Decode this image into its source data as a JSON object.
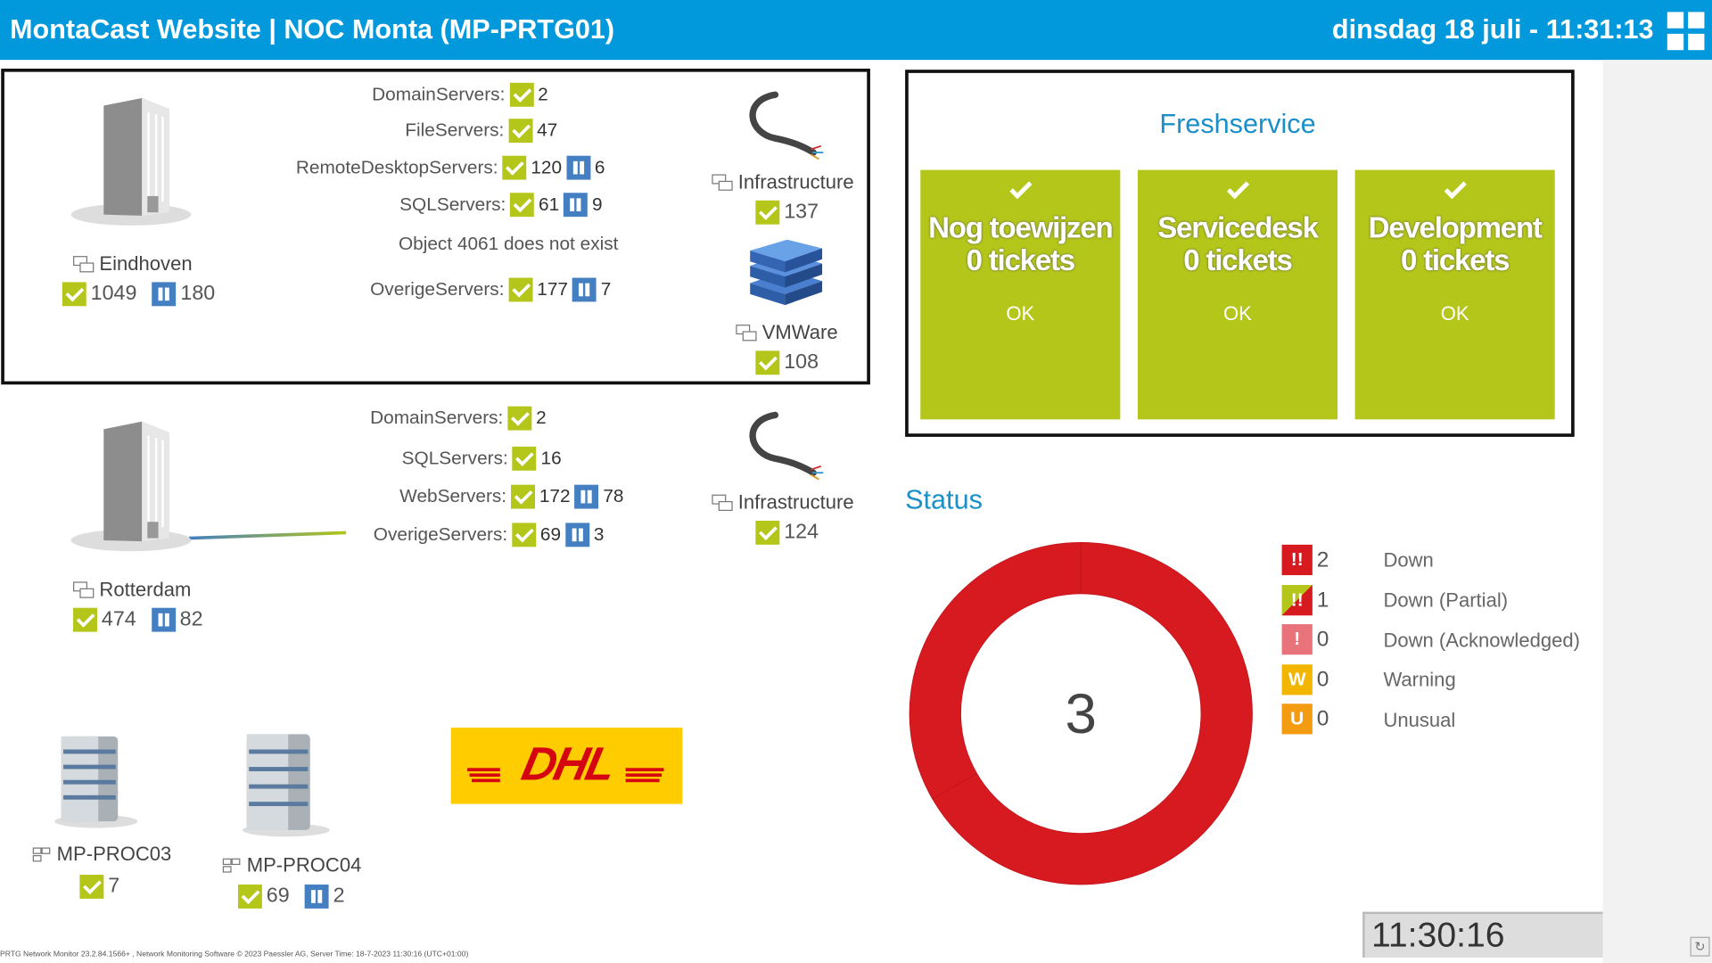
{
  "header": {
    "title": "MontaCast Website | NOC Monta (MP-PRTG01)",
    "datetime": "dinsdag 18 juli - 11:31:13"
  },
  "eindhoven": {
    "label": "Eindhoven",
    "up": "1049",
    "paused": "180",
    "rows": [
      {
        "label": "DomainServers:",
        "up": "2"
      },
      {
        "label": "FileServers:",
        "up": "47"
      },
      {
        "label": "RemoteDesktopServers:",
        "up": "120",
        "paused": "6"
      },
      {
        "label": "SQLServers:",
        "up": "61",
        "paused": "9"
      },
      {
        "label": "OverigeServers:",
        "up": "177",
        "paused": "7"
      }
    ],
    "missing": "Object 4061 does not exist",
    "infrastructure": {
      "label": "Infrastructure",
      "up": "137"
    },
    "vmware": {
      "label": "VMWare",
      "up": "108"
    }
  },
  "rotterdam": {
    "label": "Rotterdam",
    "up": "474",
    "paused": "82",
    "rows": [
      {
        "label": "DomainServers:",
        "up": "2"
      },
      {
        "label": "SQLServers:",
        "up": "16"
      },
      {
        "label": "WebServers:",
        "up": "172",
        "paused": "78"
      },
      {
        "label": "OverigeServers:",
        "up": "69",
        "paused": "3"
      }
    ],
    "infrastructure": {
      "label": "Infrastructure",
      "up": "124"
    }
  },
  "devices": [
    {
      "label": "MP-PROC03",
      "up": "7"
    },
    {
      "label": "MP-PROC04",
      "up": "69",
      "paused": "2"
    }
  ],
  "dhl": {
    "logo_text": "DHL",
    "colors": {
      "bg": "#ffcc00",
      "text": "#d40511"
    }
  },
  "freshservice": {
    "title": "Freshservice",
    "tiles": [
      {
        "name": "Nog toewijzen",
        "count": "0 tickets",
        "state": "OK"
      },
      {
        "name": "Servicedesk",
        "count": "0 tickets",
        "state": "OK"
      },
      {
        "name": "Development",
        "count": "0 tickets",
        "state": "OK"
      }
    ]
  },
  "status": {
    "title": "Status",
    "total": "3",
    "legend": [
      {
        "name": "Down",
        "count": "2",
        "icon": "!!",
        "color": "#d71920"
      },
      {
        "name": "Down (Partial)",
        "count": "1",
        "icon": "!!",
        "color": "#d71920"
      },
      {
        "name": "Down (Acknowledged)",
        "count": "0",
        "icon": "!",
        "color": "#e8737a"
      },
      {
        "name": "Warning",
        "count": "0",
        "icon": "W",
        "color": "#f2b500"
      },
      {
        "name": "Unusual",
        "count": "0",
        "icon": "U",
        "color": "#f39c12"
      }
    ]
  },
  "chart_data": {
    "type": "pie",
    "categories": [
      "Down",
      "Down (Partial)"
    ],
    "values": [
      2,
      1
    ],
    "colors": [
      "#d71920",
      "#d71920"
    ]
  },
  "footer": {
    "text": "PRTG Network Monitor 23.2.84.1566+ , Network Monitoring Software © 2023 Paessler AG, Server Time: 18-7-2023 11:30:16 (UTC+01:00)"
  },
  "clock": "11:30:16",
  "colors": {
    "header": "#0298dc",
    "ok": "#b4c619",
    "paused": "#447fc1",
    "down": "#d71920"
  }
}
